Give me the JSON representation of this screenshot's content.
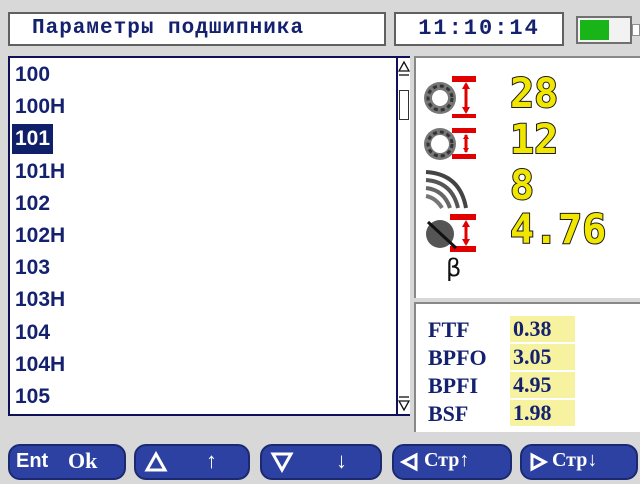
{
  "header": {
    "title": "Параметры подшипника",
    "clock": "11:10:14"
  },
  "battery": {
    "level": 0.6,
    "color": "#18b418"
  },
  "bearing_list": {
    "items": [
      "100",
      "100H",
      "101",
      "101H",
      "102",
      "102H",
      "103",
      "103H",
      "104",
      "104H",
      "105"
    ],
    "selected_index": 2
  },
  "bearing_params": {
    "rolling_elements": "28",
    "second_param": "12",
    "third_param": "8",
    "fourth_param": "4.76",
    "beta_label": "β"
  },
  "frequencies": [
    {
      "name": "FTF",
      "value": "0.38"
    },
    {
      "name": "BPFO",
      "value": "3.05"
    },
    {
      "name": "BPFI",
      "value": "4.95"
    },
    {
      "name": "BSF",
      "value": "1.98"
    }
  ],
  "footer": {
    "ok": {
      "key": "Ent",
      "label": "Ok"
    },
    "up": {
      "label": "↑"
    },
    "down": {
      "label": "↓"
    },
    "page_up": {
      "label": "Стр↑"
    },
    "page_down": {
      "label": "Стр↓"
    }
  },
  "colors": {
    "accent": "#2c41a2",
    "text": "#14216e",
    "value_yellow": "#f1e600"
  }
}
